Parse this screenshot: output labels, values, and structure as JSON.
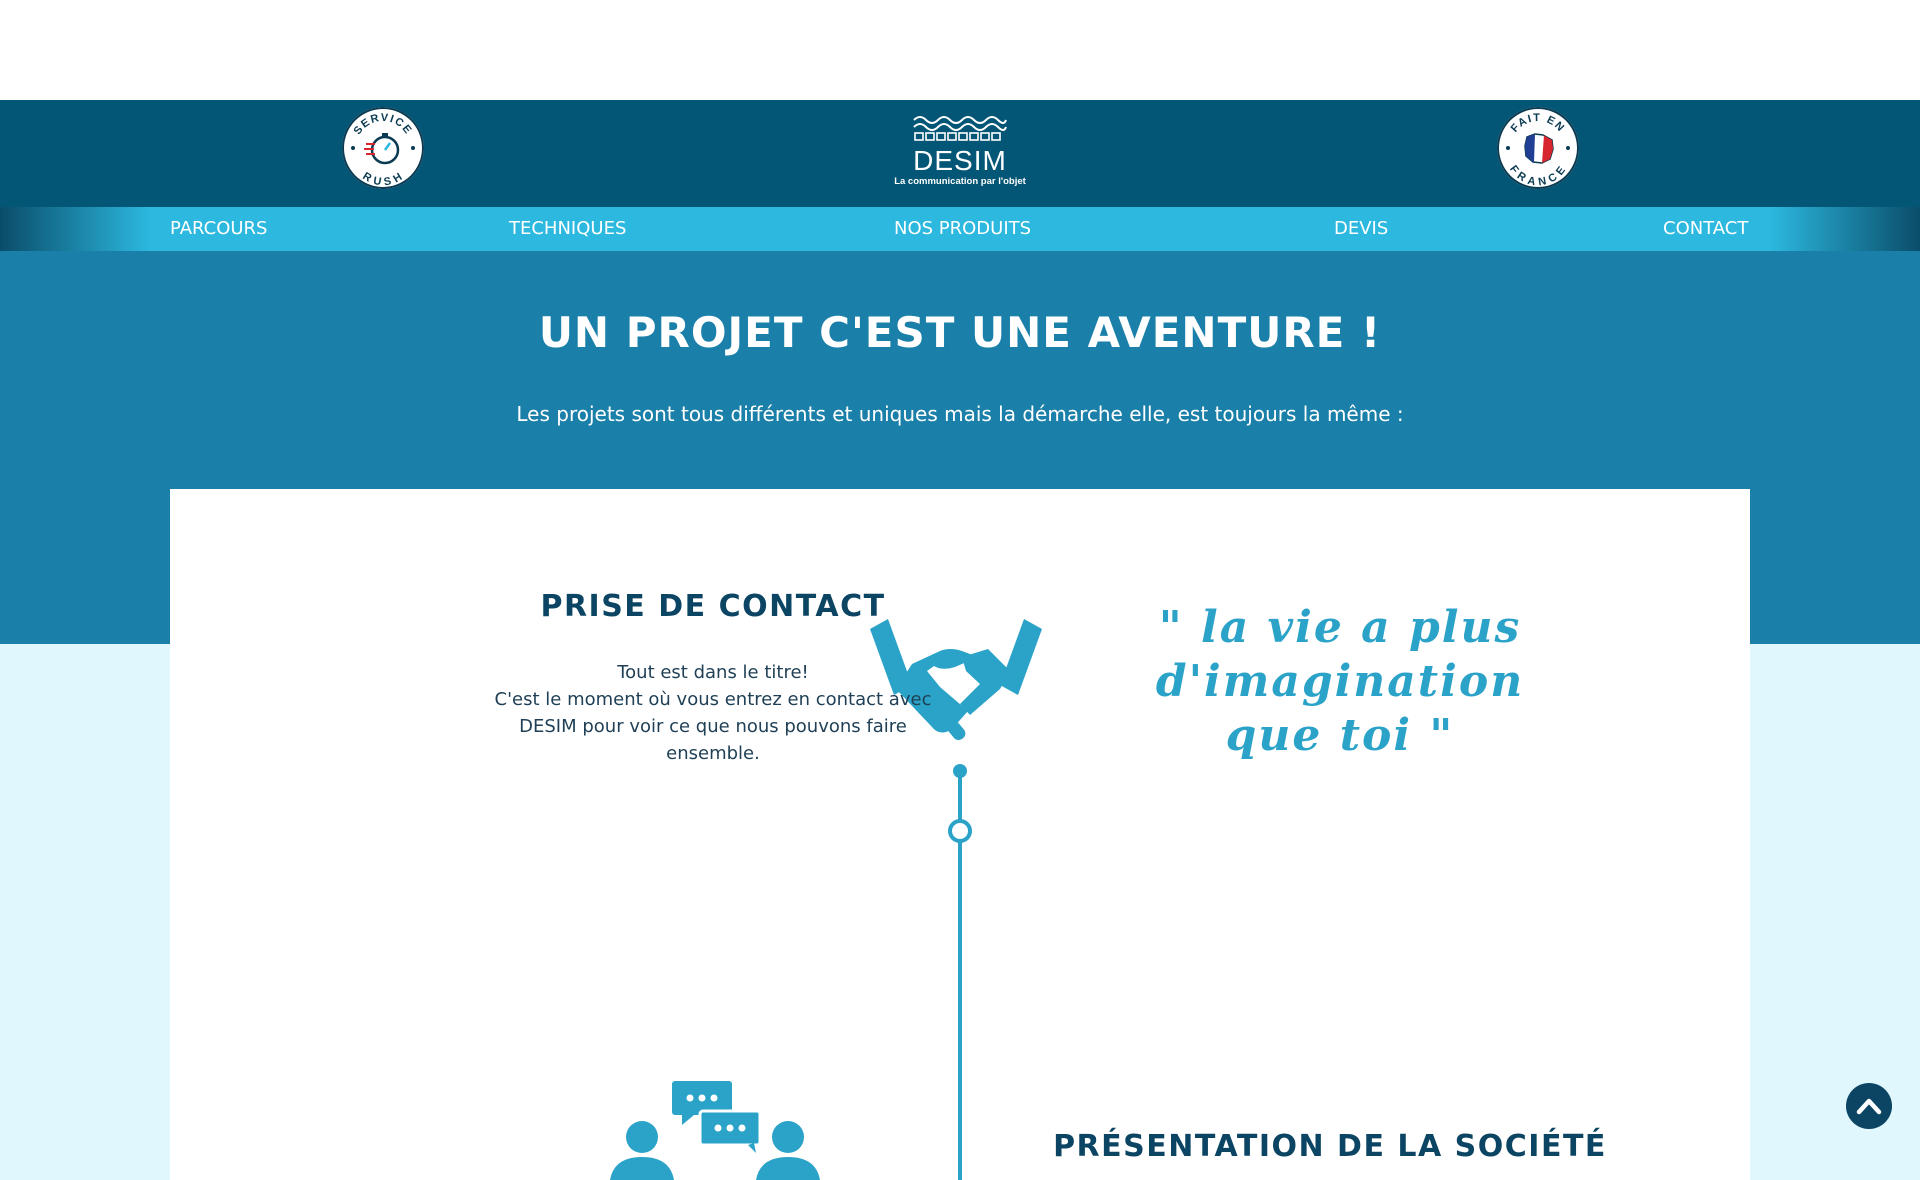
{
  "header": {
    "logo": {
      "brand": "DESIM",
      "tagline": "La communication par l'objet"
    },
    "badge_left": {
      "top_text": "SERVICE",
      "bottom_text": "RUSH"
    },
    "badge_right": {
      "top_text": "FAIT EN",
      "bottom_text": "FRANCE"
    }
  },
  "nav": {
    "items": [
      {
        "label": "PARCOURS"
      },
      {
        "label": "TECHNIQUES"
      },
      {
        "label": "NOS PRODUITS"
      },
      {
        "label": "DEVIS"
      },
      {
        "label": "CONTACT"
      }
    ]
  },
  "hero": {
    "title": "UN PROJET C'EST UNE AVENTURE  !",
    "subtitle": "Les projets sont tous différents et uniques mais la démarche elle, est toujours la même :"
  },
  "steps": [
    {
      "title": "PRISE DE CONTACT",
      "text_lines": [
        "Tout est dans le titre!",
        "C'est le moment où vous entrez en contact avec",
        "DESIM pour voir ce que nous pouvons faire",
        "ensemble."
      ],
      "icon": "handshake-icon"
    },
    {
      "title": "PRÉSENTATION DE LA SOCIÉTÉ",
      "icon": "conversation-icon"
    }
  ],
  "quote": {
    "lines": [
      "\" la vie a plus",
      "d'imagination",
      "que toi \""
    ]
  },
  "colors": {
    "header_bg": "#035675",
    "nav_bg": "#2cb8df",
    "hero_bg": "#1a80a9",
    "light_band": "#dff7fd",
    "accent": "#2ba3c8",
    "dark_text": "#0c4563"
  },
  "scroll_top": {
    "icon": "chevron-up-icon"
  }
}
